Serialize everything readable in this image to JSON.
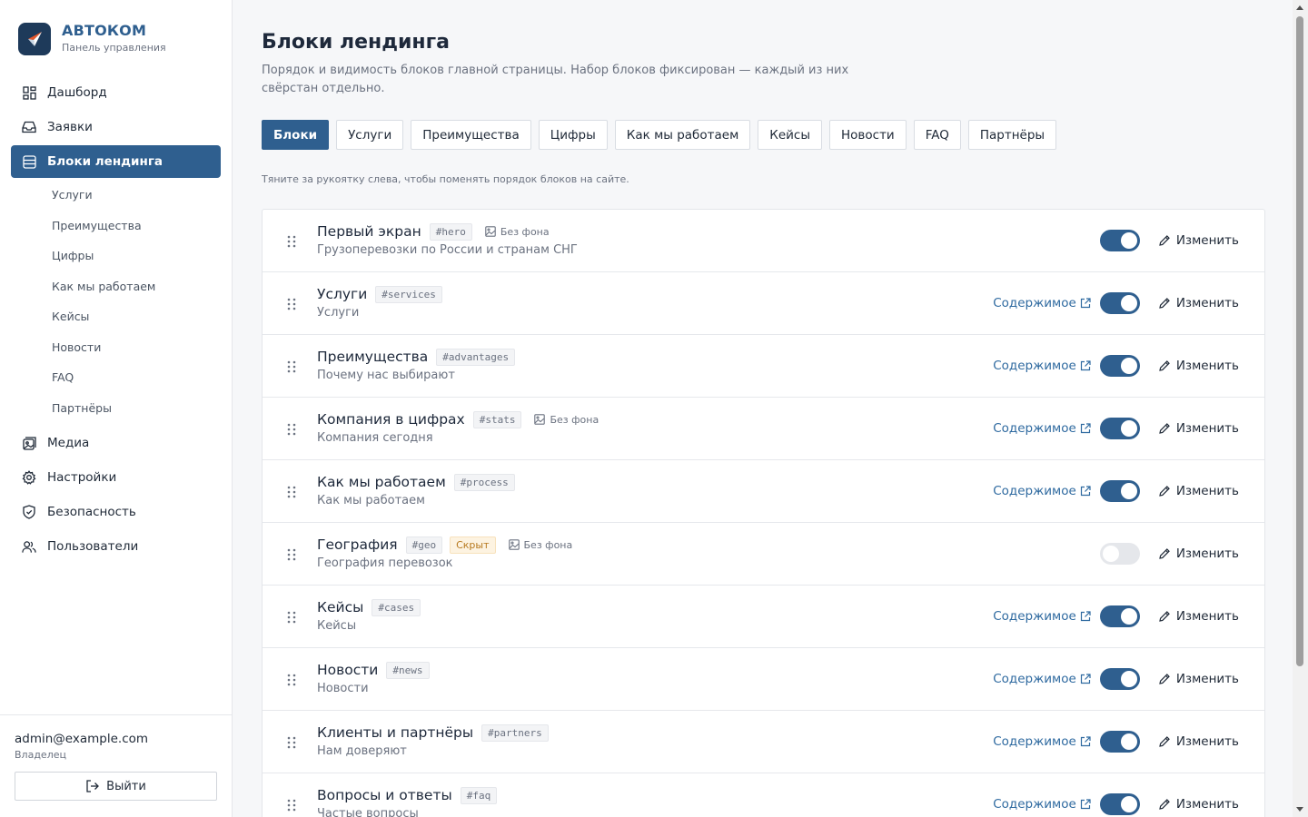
{
  "brand": {
    "name": "АВТОКОМ",
    "subtitle": "Панель управления"
  },
  "nav": {
    "dashboard": "Дашборд",
    "requests": "Заявки",
    "landing_blocks": "Блоки лендинга",
    "sub": [
      "Услуги",
      "Преимущества",
      "Цифры",
      "Как мы работаем",
      "Кейсы",
      "Новости",
      "FAQ",
      "Партнёры"
    ],
    "media": "Медиа",
    "settings": "Настройки",
    "security": "Безопасность",
    "users": "Пользователи"
  },
  "user": {
    "email": "admin@example.com",
    "role": "Владелец",
    "logout": "Выйти"
  },
  "page": {
    "title": "Блоки лендинга",
    "description": "Порядок и видимость блоков главной страницы. Набор блоков фиксирован — каждый из них свёрстан отдельно.",
    "hint": "Тяните за рукоятку слева, чтобы поменять порядок блоков на сайте."
  },
  "tabs": [
    "Блоки",
    "Услуги",
    "Преимущества",
    "Цифры",
    "Как мы работаем",
    "Кейсы",
    "Новости",
    "FAQ",
    "Партнёры"
  ],
  "labels": {
    "content": "Содержимое",
    "edit": "Изменить",
    "no_background": "Без фона",
    "hidden": "Скрыт"
  },
  "blocks": [
    {
      "title": "Первый экран",
      "anchor": "#hero",
      "subtitle": "Грузоперевозки по России и странам СНГ",
      "no_bg": true,
      "hidden": false,
      "has_content": false,
      "enabled": true
    },
    {
      "title": "Услуги",
      "anchor": "#services",
      "subtitle": "Услуги",
      "no_bg": false,
      "hidden": false,
      "has_content": true,
      "enabled": true
    },
    {
      "title": "Преимущества",
      "anchor": "#advantages",
      "subtitle": "Почему нас выбирают",
      "no_bg": false,
      "hidden": false,
      "has_content": true,
      "enabled": true
    },
    {
      "title": "Компания в цифрах",
      "anchor": "#stats",
      "subtitle": "Компания сегодня",
      "no_bg": true,
      "hidden": false,
      "has_content": true,
      "enabled": true
    },
    {
      "title": "Как мы работаем",
      "anchor": "#process",
      "subtitle": "Как мы работаем",
      "no_bg": false,
      "hidden": false,
      "has_content": true,
      "enabled": true
    },
    {
      "title": "География",
      "anchor": "#geo",
      "subtitle": "География перевозок",
      "no_bg": true,
      "hidden": true,
      "has_content": false,
      "enabled": false
    },
    {
      "title": "Кейсы",
      "anchor": "#cases",
      "subtitle": "Кейсы",
      "no_bg": false,
      "hidden": false,
      "has_content": true,
      "enabled": true
    },
    {
      "title": "Новости",
      "anchor": "#news",
      "subtitle": "Новости",
      "no_bg": false,
      "hidden": false,
      "has_content": true,
      "enabled": true
    },
    {
      "title": "Клиенты и партнёры",
      "anchor": "#partners",
      "subtitle": "Нам доверяют",
      "no_bg": false,
      "hidden": false,
      "has_content": true,
      "enabled": true
    },
    {
      "title": "Вопросы и ответы",
      "anchor": "#faq",
      "subtitle": "Частые вопросы",
      "no_bg": false,
      "hidden": false,
      "has_content": true,
      "enabled": true
    }
  ],
  "colors": {
    "primary": "#2f5f8f",
    "link": "#2f6aa0",
    "logo_bg": "#1e3a5a",
    "accent": "#e8572a"
  }
}
